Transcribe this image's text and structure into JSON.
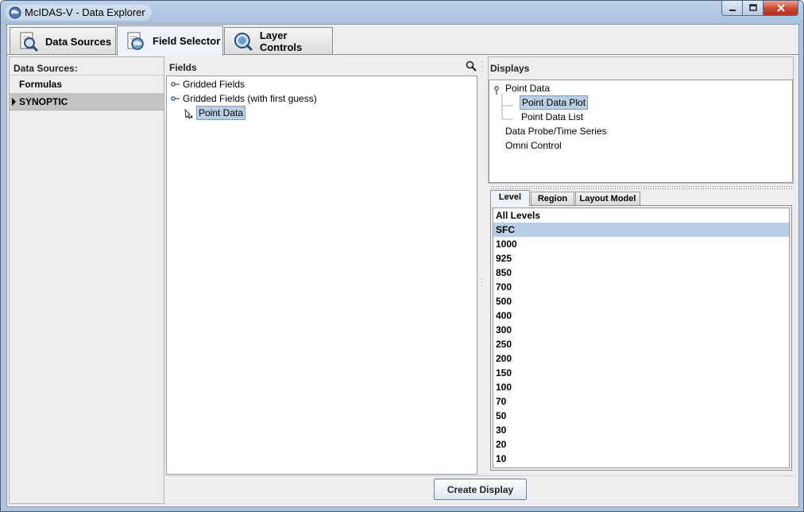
{
  "window": {
    "title": "McIDAS-V - Data Explorer"
  },
  "tabs": [
    {
      "label": "Data Sources",
      "icon": "data-sources-icon",
      "active": false
    },
    {
      "label": "Field Selector",
      "icon": "field-selector-icon",
      "active": true
    },
    {
      "label": "Layer Controls",
      "icon": "layer-controls-icon",
      "active": false
    }
  ],
  "data_sources": {
    "header": "Data Sources:",
    "items": [
      {
        "label": "Formulas",
        "selected": false
      },
      {
        "label": "SYNOPTIC",
        "selected": true
      }
    ]
  },
  "fields": {
    "title": "Fields",
    "tree": [
      {
        "label": "Gridded Fields",
        "type": "collapsed-node"
      },
      {
        "label": "Gridded Fields (with first guess)",
        "type": "collapsed-node"
      },
      {
        "label": "Point Data",
        "type": "leaf",
        "selected": true
      }
    ]
  },
  "displays": {
    "title": "Displays",
    "tree": {
      "root": "Point Data",
      "children": [
        "Point Data Plot",
        "Point Data List"
      ],
      "selected_child": "Point Data Plot",
      "others": [
        "Data Probe/Time Series",
        "Omni Control"
      ]
    }
  },
  "subtabs": [
    {
      "label": "Level",
      "active": true
    },
    {
      "label": "Region",
      "active": false
    },
    {
      "label": "Layout Model",
      "active": false
    }
  ],
  "levels": {
    "selected": "SFC",
    "items": [
      "All Levels",
      "SFC",
      "1000",
      "925",
      "850",
      "700",
      "500",
      "400",
      "300",
      "250",
      "200",
      "150",
      "100",
      "70",
      "50",
      "30",
      "20",
      "10"
    ]
  },
  "buttons": {
    "create_display": "Create Display"
  },
  "colors": {
    "selection": "#b8cfe5",
    "titlebar": "#aec4dc",
    "close_button": "#c9452c"
  }
}
